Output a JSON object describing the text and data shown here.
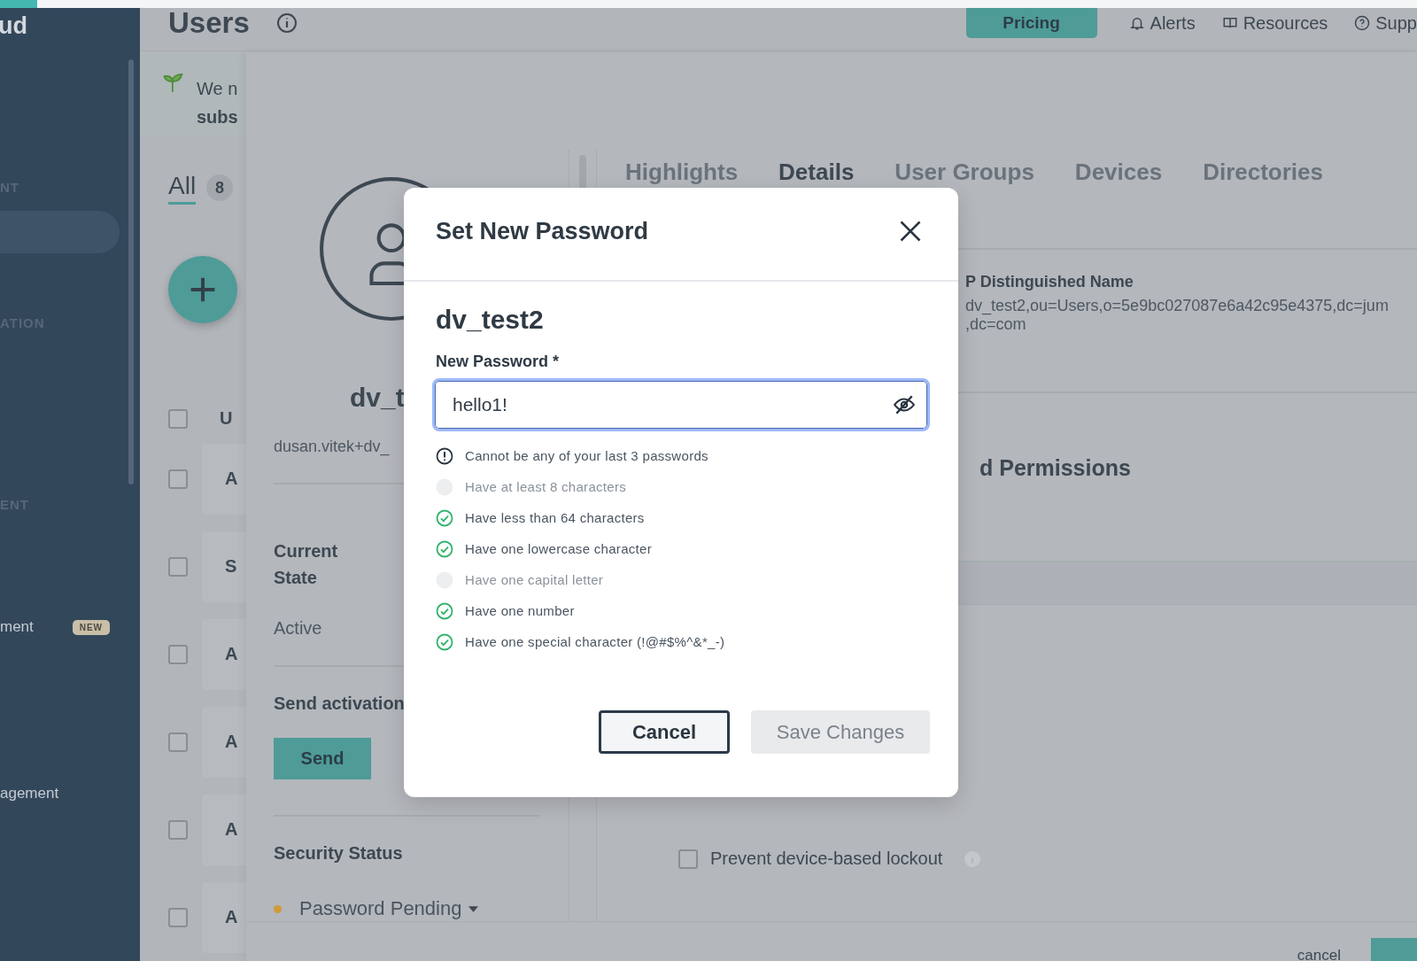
{
  "sidebar": {
    "logo": "ud",
    "items": [
      {
        "kind": "section",
        "label": "NT"
      },
      {
        "kind": "pill",
        "selected": true
      },
      {
        "kind": "section",
        "label": "ATION"
      },
      {
        "kind": "section",
        "label": "ENT"
      },
      {
        "kind": "item",
        "label": "ment",
        "badge": "NEW"
      },
      {
        "kind": "item",
        "label": "agement"
      }
    ]
  },
  "header": {
    "title": "Users",
    "pricing": "Pricing",
    "links": [
      {
        "kind": "bell",
        "label": "Alerts"
      },
      {
        "kind": "book",
        "label": "Resources"
      },
      {
        "kind": "help",
        "label": "Supp"
      }
    ]
  },
  "banner": {
    "line_1": "We n",
    "line_2": "subs"
  },
  "list_tabs": [
    {
      "label": "All",
      "count": "8",
      "selected": true
    }
  ],
  "list": {
    "header": "U",
    "header_checked": false,
    "rows": [
      {
        "label": "A",
        "checked": false
      },
      {
        "label": "S",
        "checked": false
      },
      {
        "label": "A",
        "checked": false
      },
      {
        "label": "A",
        "checked": false
      },
      {
        "label": "A",
        "checked": false
      },
      {
        "label": "A",
        "checked": false
      }
    ]
  },
  "drawer": {
    "name": "dv_t",
    "email": "dusan.vitek+dv_",
    "state_label": "Current State",
    "state_value": "Active",
    "activation_label": "Send activation",
    "send": "Send",
    "security_label": "Security Status",
    "security_value": "Password Pending",
    "tabs": [
      {
        "label": "Highlights",
        "selected": false
      },
      {
        "label": "Details",
        "selected": true
      },
      {
        "label": "User Groups",
        "selected": false
      },
      {
        "label": "Devices",
        "selected": false
      },
      {
        "label": "Directories",
        "selected": false
      }
    ],
    "dn_label": "P Distinguished Name",
    "dn_lines": [
      "dv_test2,ou=Users,o=5e9bc027087e6a42c95e4375,dc=jum",
      ",dc=com"
    ],
    "permissions": "d Permissions",
    "lockout": {
      "label": "Prevent device-based lockout",
      "checked": false
    },
    "cancel": "cancel"
  },
  "modal": {
    "title": "Set New Password",
    "user": "dv_test2",
    "field_label": "New Password *",
    "value": "hello1!",
    "rules": [
      {
        "kind": "warning",
        "text": "Cannot be any of your last 3 passwords"
      },
      {
        "kind": "check",
        "met": false,
        "text": "Have at least 8 characters"
      },
      {
        "kind": "check",
        "met": true,
        "text": "Have less than 64 characters"
      },
      {
        "kind": "check",
        "met": true,
        "text": "Have one lowercase character"
      },
      {
        "kind": "check",
        "met": false,
        "text": "Have one capital letter"
      },
      {
        "kind": "check",
        "met": true,
        "text": "Have one number"
      },
      {
        "kind": "check",
        "met": true,
        "text": "Have one special character (!@#$%^&*_-)"
      }
    ],
    "cancel": "Cancel",
    "save": {
      "label": "Save Changes",
      "disabled": true
    }
  }
}
